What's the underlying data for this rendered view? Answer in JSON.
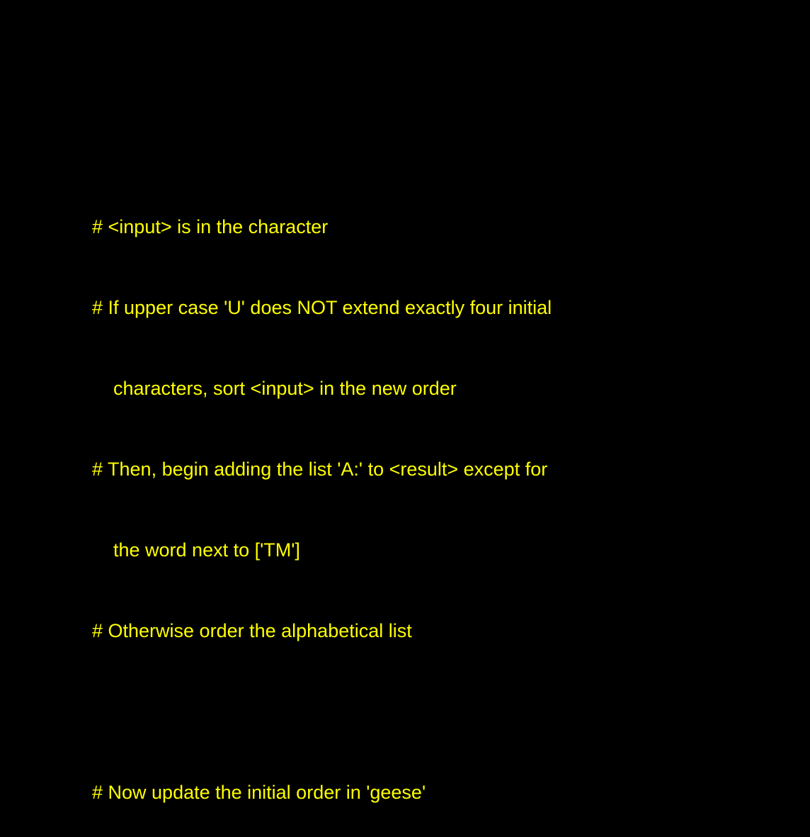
{
  "colors": {
    "background": "#000000",
    "text": "#ffff00"
  },
  "lines": [
    "# <input> is in the character",
    "# If upper case 'U' does NOT extend exactly four initial",
    "characters, sort <input> in the new order",
    "# Then, begin adding the list 'A:' to <result> except for",
    "the word next to ['TM']",
    "# Otherwise order the alphabetical list",
    "",
    "# Now update the initial order in 'geese'"
  ]
}
